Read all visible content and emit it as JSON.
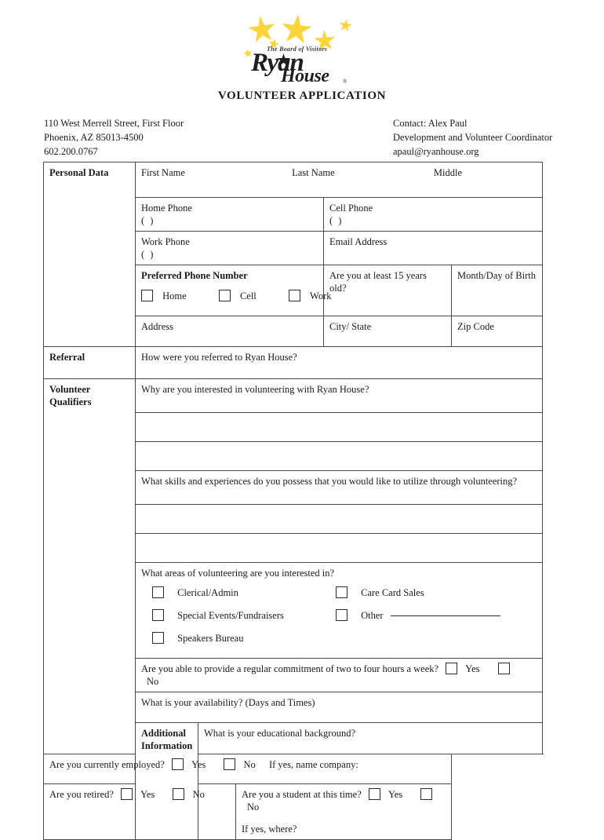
{
  "logo": {
    "board_text": "The Board of Visitors",
    "name_line1": "Ryan",
    "name_line2": "House",
    "registered_mark": "®",
    "star_color": "#FBD53A"
  },
  "title": "VOLUNTEER APPLICATION",
  "header": {
    "address_line1": "110 West Merrell Street, First Floor",
    "address_line2": "Phoenix, AZ 85013-4500",
    "phone": "602.200.0767",
    "contact_line1": "Contact: Alex Paul",
    "contact_line2": "Development and Volunteer Coordinator",
    "contact_email": "apaul@ryanhouse.org"
  },
  "sections": {
    "personal_data": "Personal Data",
    "referral": "Referral",
    "volunteer_qualifiers_line1": "Volunteer",
    "volunteer_qualifiers_line2": "Qualifiers",
    "additional_info_line1": "Additional",
    "additional_info_line2": "Information"
  },
  "personal": {
    "first_name": "First Name",
    "last_name": "Last Name",
    "middle": "Middle",
    "home_phone": "Home Phone",
    "cell_phone": "Cell Phone",
    "work_phone": "Work Phone",
    "email_address": "Email Address",
    "paren_mask": "(      )",
    "preferred_phone": "Preferred Phone Number",
    "preferred_options": [
      "Home",
      "Cell",
      "Work"
    ],
    "age_question": "Are you at least 15 years old?",
    "birth": "Month/Day of Birth",
    "address": "Address",
    "city_state": "City/ State",
    "zip_code": "Zip Code"
  },
  "referral": {
    "question": "How were you referred to Ryan House?"
  },
  "qualifiers": {
    "why_question": "Why are you interested in volunteering with Ryan House?",
    "skills_question": "What skills and experiences do you possess that you would like to utilize through volunteering?",
    "areas_question": "What areas of volunteering are you interested in?",
    "areas_col1": [
      "Clerical/Admin",
      "Special Events/Fundraisers",
      "Speakers Bureau"
    ],
    "areas_col2": [
      "Care Card Sales",
      "Other"
    ],
    "commitment_question": "Are you able to provide a regular commitment of two to four hours a week?",
    "commitment_yes": "Yes",
    "commitment_no": "No",
    "availability_question": "What is your availability? (Days and Times)"
  },
  "additional": {
    "education_question": "What is your educational background?",
    "employed_question": "Are you currently employed?",
    "employed_yes": "Yes",
    "employed_no": "No",
    "employed_followup": "If yes, name company:",
    "retired_question": "Are you retired?",
    "retired_yes": "Yes",
    "retired_no": "No",
    "student_question": "Are you a student at this time?",
    "student_yes": "Yes",
    "student_no": "No",
    "student_followup": "If yes, where?"
  }
}
